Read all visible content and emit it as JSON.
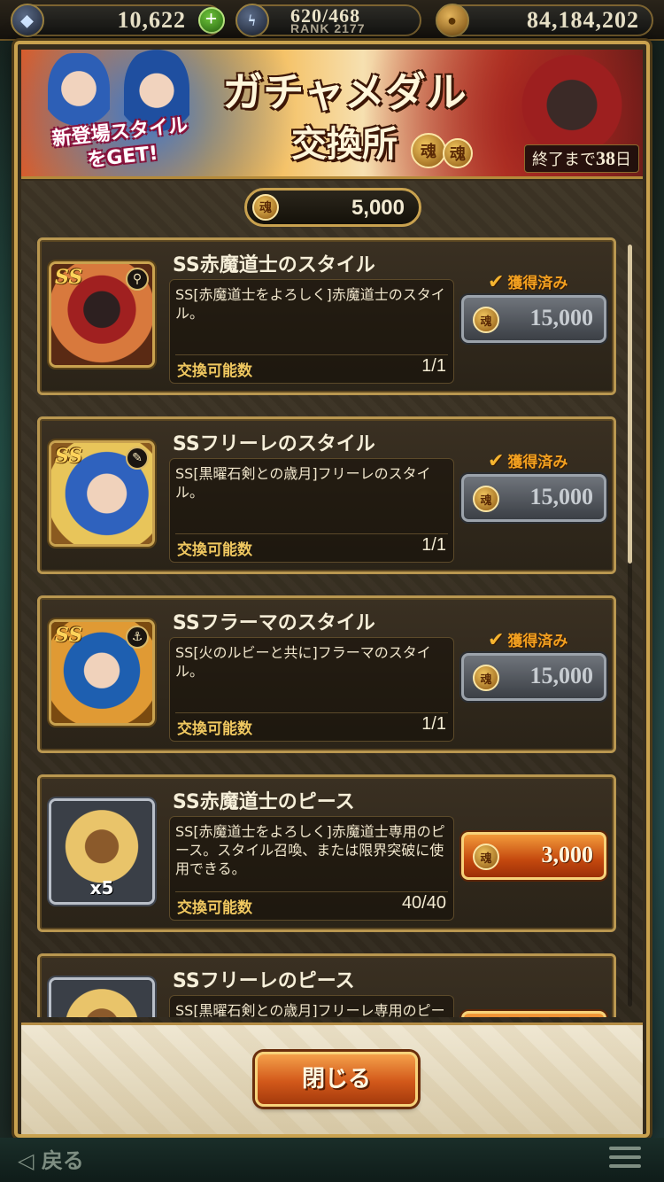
{
  "status_bar": {
    "gems": "10,622",
    "stamina": "620/468",
    "rank": "RANK 2177",
    "gold": "84,184,202",
    "plus": "+"
  },
  "banner": {
    "title_line1": "ガチャメダル",
    "title_line2": "交換所",
    "promo_line1": "新登場スタイル",
    "promo_line2": "をGET!",
    "days_prefix": "終了まで",
    "days_value": "38",
    "days_suffix": "日"
  },
  "medal_balance": "5,000",
  "medal_glyph": "魂",
  "items": [
    {
      "name": "SS赤魔道士のスタイル",
      "badge": "SS",
      "weapon_icon": "staff-icon",
      "weapon_glyph": "⚲",
      "description": "SS[赤魔道士をよろしく]赤魔道士のスタイル。",
      "limit_label": "交換可能数",
      "limit": "1/1",
      "obtained_label": "獲得済み",
      "price": "15,000",
      "available": false
    },
    {
      "name": "SSフリーレのスタイル",
      "badge": "SS",
      "weapon_icon": "sword-icon",
      "weapon_glyph": "✎",
      "description": "SS[黒曜石剣との歳月]フリーレのスタイル。",
      "limit_label": "交換可能数",
      "limit": "1/1",
      "obtained_label": "獲得済み",
      "price": "15,000",
      "available": false
    },
    {
      "name": "SSフラーマのスタイル",
      "badge": "SS",
      "weapon_icon": "dagger-icon",
      "weapon_glyph": "⚓",
      "description": "SS[火のルビーと共に]フラーマのスタイル。",
      "limit_label": "交換可能数",
      "limit": "1/1",
      "obtained_label": "獲得済み",
      "price": "15,000",
      "available": false
    },
    {
      "name": "SS赤魔道士のピース",
      "quantity": "x5",
      "description": "SS[赤魔道士をよろしく]赤魔道士専用のピース。スタイル召喚、または限界突破に使用できる。",
      "limit_label": "交換可能数",
      "limit": "40/40",
      "price": "3,000",
      "available": true
    },
    {
      "name": "SSフリーレのピース",
      "description": "SS[黒曜石剣との歳月]フリーレ専用のピー",
      "available": true
    }
  ],
  "footer": {
    "close_label": "閉じる"
  },
  "bottom_nav": {
    "back_label": "◁ 戻る"
  }
}
